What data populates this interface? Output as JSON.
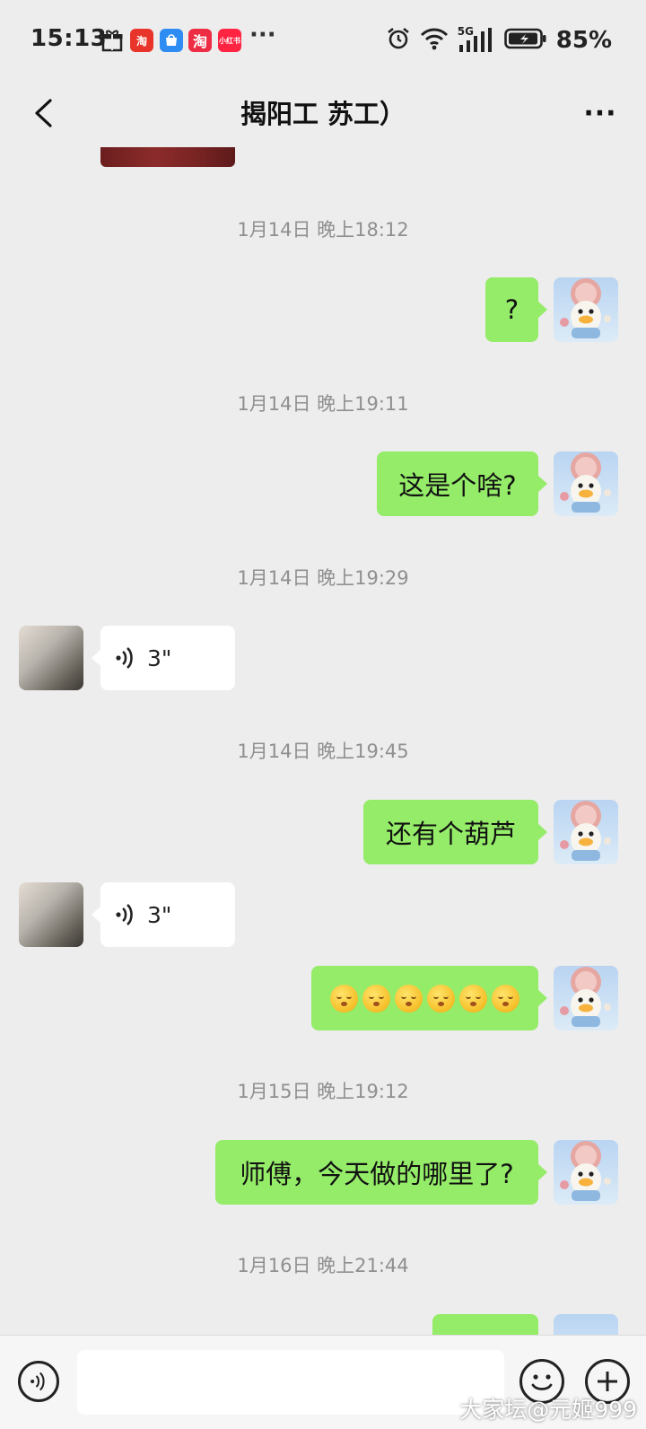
{
  "status_bar": {
    "time": "15:13",
    "app_icons": [
      {
        "name": "gift-icon",
        "label": ""
      },
      {
        "name": "taobao-special-icon",
        "label": "淘",
        "color": "#e8342b"
      },
      {
        "name": "honor-store-icon",
        "label": "",
        "color": "#2e8cf2"
      },
      {
        "name": "taobao-icon",
        "label": "淘",
        "color": "#ee2c43"
      },
      {
        "name": "xiaohongshu-icon",
        "label": "小红书",
        "color": "#ff2442"
      }
    ],
    "more": "···",
    "network": "5G",
    "battery": "85%"
  },
  "nav": {
    "title": "揭阳工 苏工）",
    "more": "···"
  },
  "messages": [
    {
      "type": "time",
      "text": "1月14日 晚上18:12"
    },
    {
      "type": "out",
      "text": "?"
    },
    {
      "type": "time",
      "text": "1月14日 晚上19:11"
    },
    {
      "type": "out",
      "text": "这是个啥?"
    },
    {
      "type": "time",
      "text": "1月14日 晚上19:29"
    },
    {
      "type": "voice_in",
      "duration": "3\""
    },
    {
      "type": "time",
      "text": "1月14日 晚上19:45"
    },
    {
      "type": "out",
      "text": "还有个葫芦"
    },
    {
      "type": "voice_in",
      "duration": "3\""
    },
    {
      "type": "out_emoji",
      "emoji": "😚",
      "count": 6
    },
    {
      "type": "time",
      "text": "1月15日 晚上19:12"
    },
    {
      "type": "out",
      "text": "师傅，今天做的哪里了?"
    },
    {
      "type": "time",
      "text": "1月16日 晚上21:44"
    }
  ],
  "input_bar": {
    "placeholder": "",
    "value": ""
  },
  "watermark": "大家坛@元姬999",
  "colors": {
    "background": "#ededed",
    "outgoing_bubble": "#95ec69",
    "incoming_bubble": "#ffffff",
    "timestamp": "#8f8f8f"
  }
}
